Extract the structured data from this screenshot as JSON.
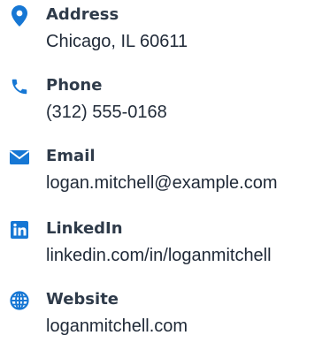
{
  "accent_color": "#1677d4",
  "contacts": [
    {
      "icon": "map-pin-icon",
      "label": "Address",
      "value": "Chicago, IL 60611"
    },
    {
      "icon": "phone-icon",
      "label": "Phone",
      "value": "(312) 555-0168"
    },
    {
      "icon": "envelope-icon",
      "label": "Email",
      "value": "logan.mitchell@example.com"
    },
    {
      "icon": "linkedin-icon",
      "label": "LinkedIn",
      "value": "linkedin.com/in/loganmitchell"
    },
    {
      "icon": "globe-icon",
      "label": "Website",
      "value": "loganmitchell.com"
    }
  ]
}
